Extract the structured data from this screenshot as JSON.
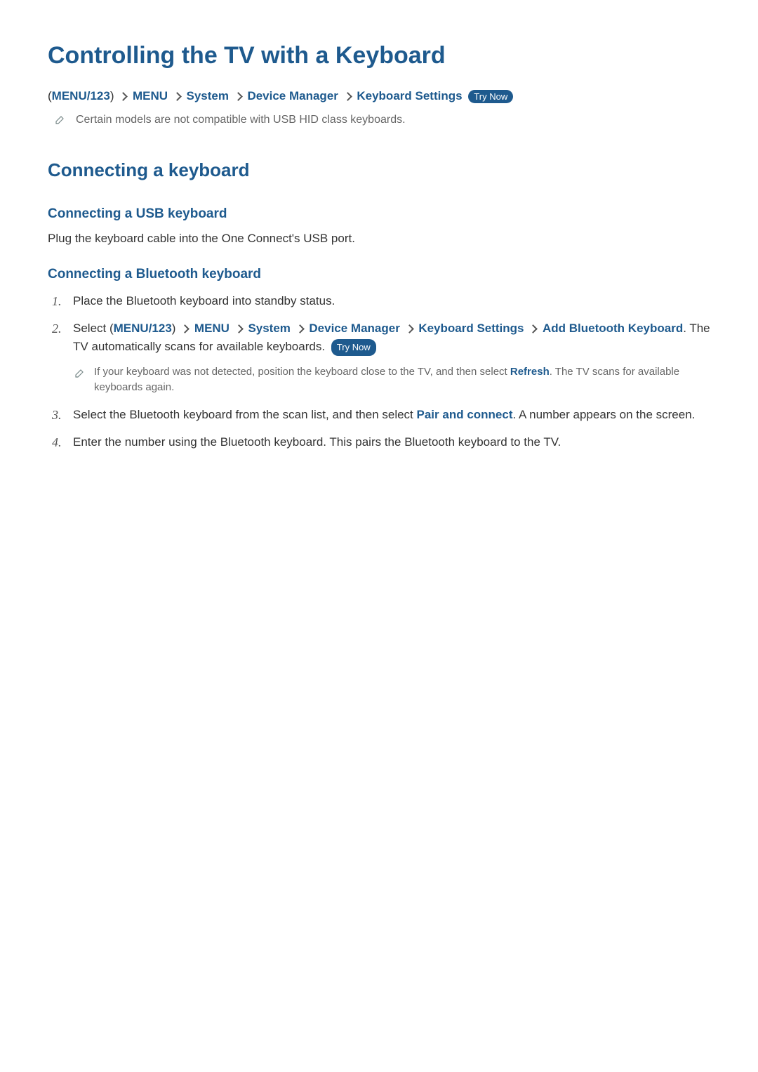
{
  "title": "Controlling the TV with a Keyboard",
  "breadcrumb1": {
    "menu123": "MENU/123",
    "items": [
      "MENU",
      "System",
      "Device Manager",
      "Keyboard Settings"
    ],
    "tryNow": "Try Now"
  },
  "note1": "Certain models are not compatible with USB HID class keyboards.",
  "section1": {
    "heading": "Connecting a keyboard",
    "usb": {
      "heading": "Connecting a USB keyboard",
      "text": "Plug the keyboard cable into the One Connect's USB port."
    },
    "bt": {
      "heading": "Connecting a Bluetooth keyboard",
      "steps": {
        "s1": "Place the Bluetooth keyboard into standby status.",
        "s2_prefix": "Select (",
        "s2_menu123": "MENU/123",
        "s2_paren_close": ") ",
        "s2_items": [
          "MENU",
          "System",
          "Device Manager",
          "Keyboard Settings",
          "Add Bluetooth Keyboard"
        ],
        "s2_suffix": ". The TV automatically scans for available keyboards. ",
        "s2_tryNow": "Try Now",
        "s2_note_a": "If your keyboard was not detected, position the keyboard close to the TV, and then select ",
        "s2_note_refresh": "Refresh",
        "s2_note_b": ". The TV scans for available keyboards again.",
        "s3_a": "Select the Bluetooth keyboard from the scan list, and then select ",
        "s3_link": "Pair and connect",
        "s3_b": ". A number appears on the screen.",
        "s4": "Enter the number using the Bluetooth keyboard. This pairs the Bluetooth keyboard to the TV."
      }
    }
  }
}
